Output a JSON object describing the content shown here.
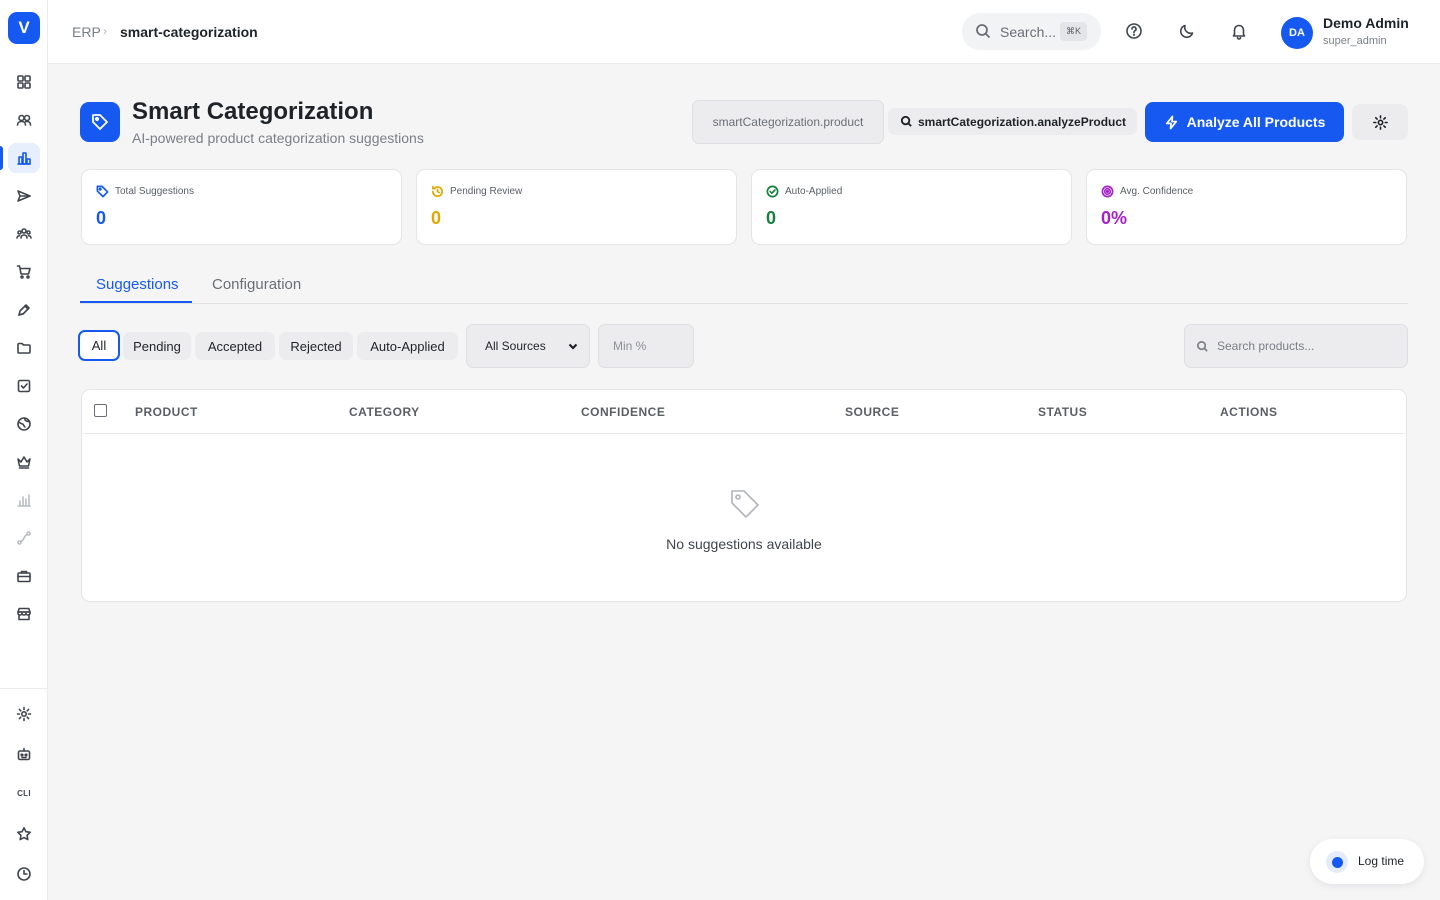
{
  "app": {
    "logo_letter": "V"
  },
  "breadcrumb": {
    "root": "ERP",
    "separator": "›",
    "current": "smart-categorization"
  },
  "topbar": {
    "search_placeholder": "Search...",
    "shortcut": "⌘K",
    "user_name": "Demo Admin",
    "user_role": "super_admin",
    "avatar_initials": "DA"
  },
  "sidebar": {
    "items": [
      "dashboard-icon",
      "users-icon",
      "analytics-icon",
      "campaign-icon",
      "team-icon",
      "cart-icon",
      "pen-icon",
      "folder-icon",
      "checklist-icon",
      "globe-icon",
      "crown-icon",
      "chart-icon",
      "workflow-icon",
      "briefcase-icon",
      "store-icon"
    ],
    "bottom_items": [
      "settings-icon",
      "robot-icon",
      "cli-label",
      "star-icon",
      "clock-icon"
    ],
    "cli_label": "CLI",
    "active_index": 2
  },
  "header": {
    "title": "Smart Categorization",
    "subtitle": "AI-powered product categorization suggestions",
    "permission_box": "smartCategorization.product",
    "permission_chip": "smartCategorization.analyzeProduct",
    "primary_action": "Analyze All Products"
  },
  "stats": [
    {
      "label": "Total Suggestions",
      "value": "0",
      "color": "#1559f0",
      "icon": "tag-icon"
    },
    {
      "label": "Pending Review",
      "value": "0",
      "color": "#e0a800",
      "icon": "history-icon"
    },
    {
      "label": "Auto-Applied",
      "value": "0",
      "color": "#16803c",
      "icon": "check-circle-icon"
    },
    {
      "label": "Avg. Confidence",
      "value": "0%",
      "color": "#a321c8",
      "icon": "target-icon"
    }
  ],
  "tabs": [
    {
      "label": "Suggestions",
      "active": true
    },
    {
      "label": "Configuration",
      "active": false
    }
  ],
  "filters": {
    "status_chips": [
      "All",
      "Pending",
      "Accepted",
      "Rejected",
      "Auto-Applied"
    ],
    "active_chip": "All",
    "source_select": "All Sources",
    "min_placeholder": "Min %",
    "search_placeholder": "Search products..."
  },
  "table": {
    "columns": [
      "PRODUCT",
      "CATEGORY",
      "CONFIDENCE",
      "SOURCE",
      "STATUS",
      "ACTIONS"
    ],
    "rows": [],
    "empty_message": "No suggestions available"
  },
  "log_time": {
    "label": "Log time"
  },
  "colors": {
    "accent": "#1559f0"
  }
}
